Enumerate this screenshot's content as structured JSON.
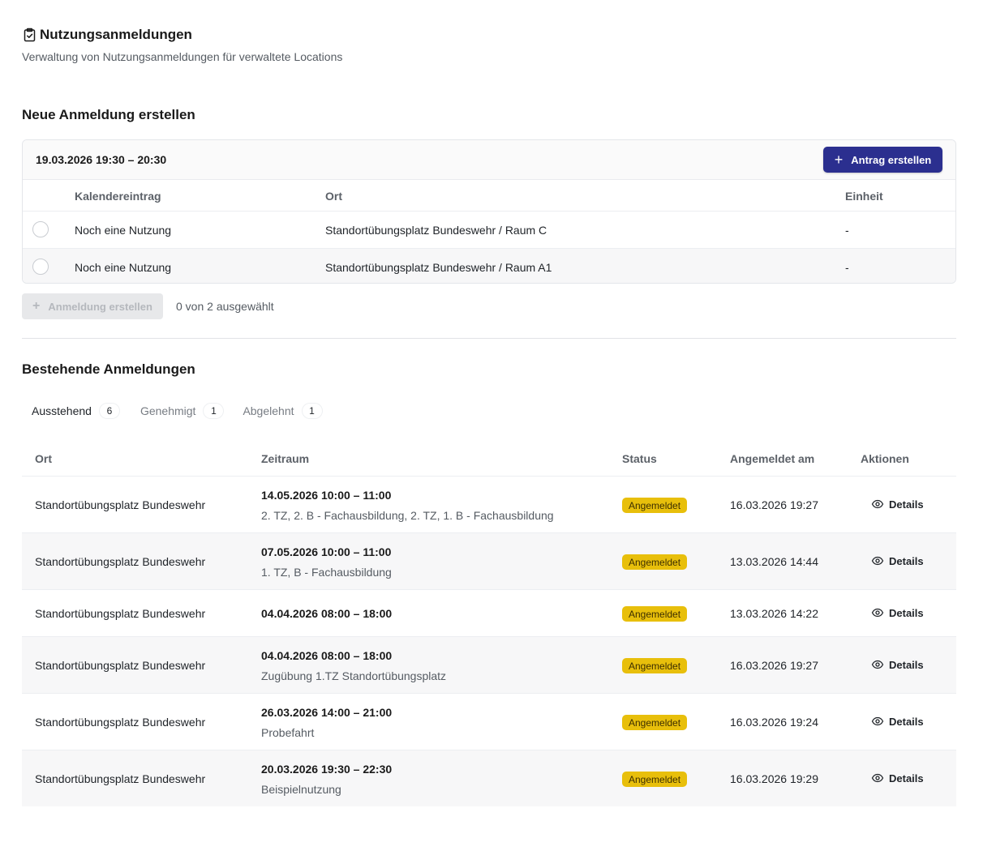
{
  "header": {
    "title": "Nutzungsanmeldungen",
    "subtitle": "Verwaltung von Nutzungsanmeldungen für verwaltete Locations",
    "icon": "clipboard-check-icon"
  },
  "new_section": {
    "title": "Neue Anmeldung erstellen",
    "date_range": "19.03.2026 19:30 – 20:30",
    "create_request_label": "Antrag erstellen",
    "columns": {
      "calendar": "Kalendereintrag",
      "location": "Ort",
      "unit": "Einheit"
    },
    "rows": [
      {
        "calendar": "Noch eine Nutzung",
        "location": "Standortübungsplatz Bundeswehr / Raum C",
        "unit": "-"
      },
      {
        "calendar": "Noch eine Nutzung",
        "location": "Standortübungsplatz Bundeswehr / Raum A1",
        "unit": "-"
      }
    ],
    "create_registration_label": "Anmeldung erstellen",
    "selection_status": "0 von 2 ausgewählt"
  },
  "existing_section": {
    "title": "Bestehende Anmeldungen",
    "tabs": [
      {
        "label": "Ausstehend",
        "count": "6",
        "active": true
      },
      {
        "label": "Genehmigt",
        "count": "1",
        "active": false
      },
      {
        "label": "Abgelehnt",
        "count": "1",
        "active": false
      }
    ],
    "columns": {
      "location": "Ort",
      "period": "Zeitraum",
      "status": "Status",
      "registered_at": "Angemeldet am",
      "actions": "Aktionen"
    },
    "rows": [
      {
        "location": "Standortübungsplatz Bundeswehr",
        "period": "14.05.2026 10:00 – 11:00",
        "description": "2. TZ, 2. B - Fachausbildung, 2. TZ, 1. B - Fachausbildung",
        "status": "Angemeldet",
        "registered_at": "16.03.2026 19:27",
        "action": "Details"
      },
      {
        "location": "Standortübungsplatz Bundeswehr",
        "period": "07.05.2026 10:00 – 11:00",
        "description": "1. TZ, B - Fachausbildung",
        "status": "Angemeldet",
        "registered_at": "13.03.2026 14:44",
        "action": "Details"
      },
      {
        "location": "Standortübungsplatz Bundeswehr",
        "period": "04.04.2026 08:00 – 18:00",
        "description": "",
        "status": "Angemeldet",
        "registered_at": "13.03.2026 14:22",
        "action": "Details"
      },
      {
        "location": "Standortübungsplatz Bundeswehr",
        "period": "04.04.2026 08:00 – 18:00",
        "description": "Zugübung 1.TZ Standortübungsplatz",
        "status": "Angemeldet",
        "registered_at": "16.03.2026 19:27",
        "action": "Details"
      },
      {
        "location": "Standortübungsplatz Bundeswehr",
        "period": "26.03.2026 14:00 – 21:00",
        "description": "Probefahrt",
        "status": "Angemeldet",
        "registered_at": "16.03.2026 19:24",
        "action": "Details"
      },
      {
        "location": "Standortübungsplatz Bundeswehr",
        "period": "20.03.2026 19:30 – 22:30",
        "description": "Beispielnutzung",
        "status": "Angemeldet",
        "registered_at": "16.03.2026 19:29",
        "action": "Details"
      }
    ]
  },
  "colors": {
    "primary": "#2b2f8f",
    "status_badge": "#e8bf0b"
  }
}
